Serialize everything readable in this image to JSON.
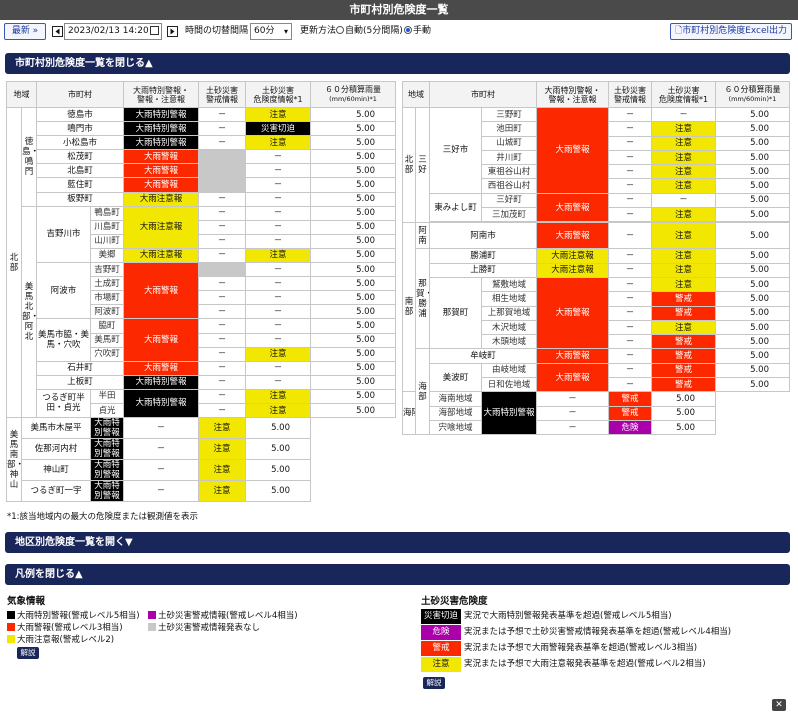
{
  "page": {
    "title": "市町村別危険度一覧"
  },
  "toolbar": {
    "latest_label": "最新 »",
    "datetime": "2023/02/13 14:20",
    "interval_label": "時間の切替間隔",
    "interval_value": "60分",
    "update_label": "更新方法",
    "auto_label": "自動(5分間隔)",
    "manual_label": "手動",
    "excel_label": "市町村別危険度Excel出力"
  },
  "sections": {
    "city_list_toggle": "市町村別危険度一覧を閉じる▲",
    "district_toggle": "地区別危険度一覧を開く▼",
    "legend_toggle": "凡例を閉じる▲"
  },
  "table_headers": {
    "region": "地域",
    "city": "市町村",
    "warn_line1": "大雨特別警報・",
    "warn_line2": "警報・注意報",
    "doshu_info_line1": "土砂災害",
    "doshu_info_line2": "警戒情報",
    "doshu_risk_line1": "土砂災害",
    "doshu_risk_line2": "危険度情報*1",
    "rain_line1": "６０分積算雨量",
    "rain_line2": "(mm/60min)*1"
  },
  "colors": {
    "level5": "#000000",
    "level4": "#aa00aa",
    "level3": "#fc2800",
    "level2": "#f2e700",
    "nav": "#19265a"
  },
  "labels": {
    "w5": "大雨特別警報",
    "w3": "大雨警報",
    "w2": "大雨注意報",
    "dash": "－",
    "d5": "災害切迫",
    "d4": "危険",
    "d3": "警戒",
    "d2": "注意",
    "rain": "5.00"
  },
  "left_table": {
    "region_north": "北部",
    "sub_tokushima": "徳島・鳴門",
    "sub_mima_north": "美馬北部・阿北",
    "sub_mima_south": "美馬南部・神山",
    "cities": {
      "tokushima": "徳島市",
      "naruto": "鳴門市",
      "komatsushima": "小松島市",
      "matsushige": "松茂町",
      "kitajima": "北島町",
      "aizumi": "藍住町",
      "itano": "板野町",
      "yoshinogawa": "吉野川市",
      "kamojima": "鴨島町",
      "kawashima": "川島町",
      "yamakawa": "山川町",
      "misato": "美郷",
      "awa": "阿波市",
      "yoshino": "吉野町",
      "donari": "土成町",
      "ichiba": "市場町",
      "awacho": "阿波町",
      "mima_waki_group": "美馬市脇・美馬・穴吹",
      "waki": "脇町",
      "mima": "美馬町",
      "anabuki": "穴吹町",
      "ishii": "石井町",
      "kamiita": "上板町",
      "tsurugi_handa_group": "つるぎ町半田・貞光",
      "handa": "半田",
      "sadamitsu": "貞光",
      "mima_koyadaira": "美馬市木屋平",
      "sanagochi": "佐那河内村",
      "kamiyama": "神山町",
      "tsurugi_ichiu": "つるぎ町一宇"
    }
  },
  "right_table": {
    "region_north": "北部",
    "region_south": "南部",
    "sub_miyoshi": "三好",
    "sub_anan": "阿南",
    "sub_nakagatsuura": "那賀・勝浦",
    "sub_kaibu": "海部",
    "cities": {
      "miyoshi": "三好市",
      "miyoshicho": "三野町",
      "ikeda": "池田町",
      "yamashiro": "山城町",
      "iyama": "井川町",
      "higashiiyadani": "東祖谷山村",
      "nishiiyadani": "西祖谷山村",
      "higashimiyoshi": "東みよし町",
      "mino": "三好町",
      "mikamo": "三加茂町",
      "anan": "阿南市",
      "katsuura": "勝浦町",
      "kamikatsu": "上勝町",
      "naka": "那賀町",
      "washiki": "鷲敷地域",
      "aioi": "相生地域",
      "kamina": "上那賀地域",
      "kisawa": "木沢地域",
      "kitō": "木頭地域",
      "mugi": "牟岐町",
      "minami": "美波町",
      "yuki": "由岐地域",
      "hiwasa": "日和佐地域",
      "kaiyo": "海陽町",
      "kainan": "海南地域",
      "kaifu": "海部地域",
      "shishikui": "宍喰地域"
    }
  },
  "footnote": "*1:該当地域内の最大の危険度または観測値を表示",
  "legend": {
    "kisho_title": "気象情報",
    "doshu_title": "土砂災害危険度",
    "w5_item": "大雨特別警報(警戒レベル5相当)",
    "w3_item": "大雨警報(警戒レベル3相当)",
    "w2_item": "大雨注意報(警戒レベル2)",
    "dk_item": "土砂災害警戒情報(警戒レベル4相当)",
    "dn_item": "土砂災害警戒情報発表なし",
    "kaisetsu": "解説",
    "d5_text": "実況で大雨特別警報発表基準を超過(警戒レベル5相当)",
    "d4_text": "実況または予想で土砂災害警戒情報発表基準を超過(警戒レベル4相当)",
    "d3_text": "実況または予想で大雨警報発表基準を超過(警戒レベル3相当)",
    "d2_text": "実況または予想で大雨注意報発表基準を超過(警戒レベル2相当)"
  }
}
